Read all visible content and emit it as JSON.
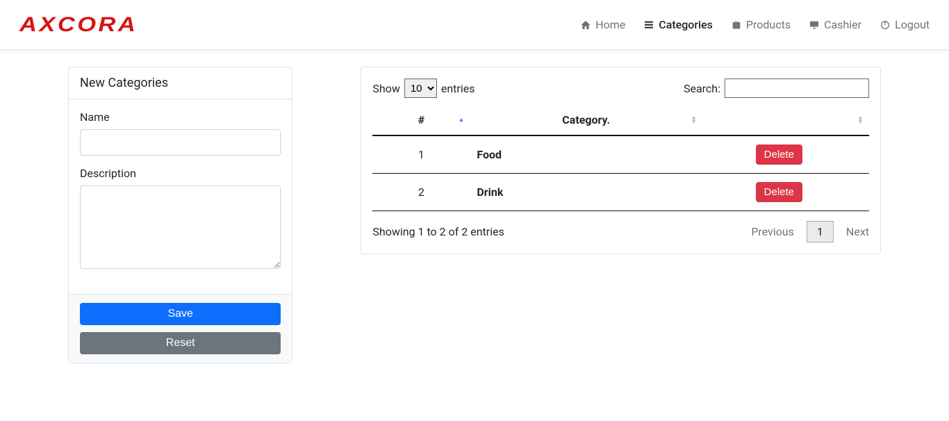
{
  "brand": "AXCORA",
  "nav": {
    "home": "Home",
    "categories": "Categories",
    "products": "Products",
    "cashier": "Cashier",
    "logout": "Logout"
  },
  "form": {
    "title": "New Categories",
    "name_label": "Name",
    "desc_label": "Description",
    "save": "Save",
    "reset": "Reset"
  },
  "table": {
    "show_prefix": "Show",
    "show_suffix": "entries",
    "length_value": "10",
    "search_label": "Search:",
    "col_index": "#",
    "col_category": "Category.",
    "rows": [
      {
        "n": "1",
        "name": "Food",
        "action": "Delete"
      },
      {
        "n": "2",
        "name": "Drink",
        "action": "Delete"
      }
    ],
    "info": "Showing 1 to 2 of 2 entries",
    "prev": "Previous",
    "page": "1",
    "next": "Next"
  }
}
